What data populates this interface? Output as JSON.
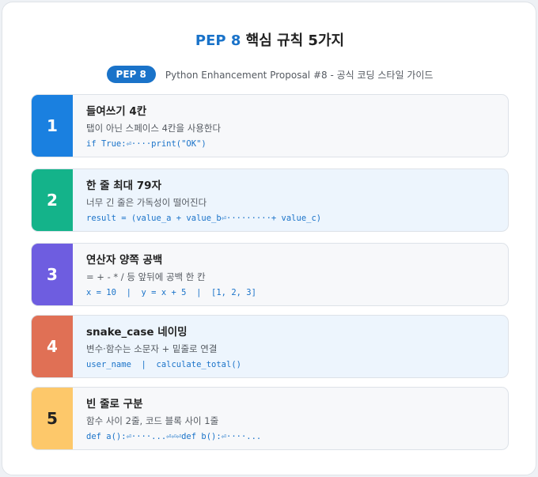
{
  "header": {
    "title_accent": "PEP 8",
    "title_rest": " 핵심 규칙 5가지",
    "badge": "PEP 8",
    "subtitle": "Python Enhancement Proposal #8 - 공식 코딩 스타일 가이드"
  },
  "rules": [
    {
      "number": "1",
      "title": "들여쓰기 4칸",
      "description": "탭이 아닌 스페이스 4칸을 사용한다",
      "code": "if True:⏎····print(\"OK\")",
      "color": "#1a80e0"
    },
    {
      "number": "2",
      "title": "한 줄 최대 79자",
      "description": "너무 긴 줄은 가독성이 떨어진다",
      "code": "result = (value_a + value_b⏎·········+ value_c)",
      "color": "#14b38a"
    },
    {
      "number": "3",
      "title": "연산자 양쪽 공백",
      "description": "= + - * / 등 앞뒤에 공백 한 칸",
      "code": "x = 10  |  y = x + 5  |  [1, 2, 3]",
      "color": "#6e5de0"
    },
    {
      "number": "4",
      "title": "snake_case 네이밍",
      "description": "변수·함수는 소문자 + 밑줄로 연결",
      "code": "user_name  |  calculate_total()",
      "color": "#e07055"
    },
    {
      "number": "5",
      "title": "빈 줄로 구분",
      "description": "함수 사이 2줄, 코드 블록 사이 1줄",
      "code": "def a():⏎····...⏎⏎⏎def b():⏎····...",
      "color": "#fdc86a"
    }
  ]
}
